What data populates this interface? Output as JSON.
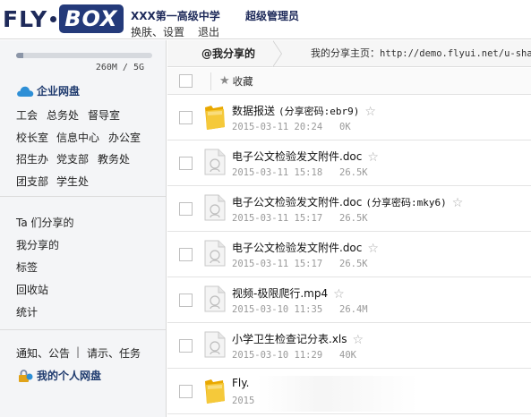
{
  "header": {
    "logo_left": "FLY",
    "logo_right": "BOX",
    "school": "XXX第一高级中学",
    "admin": "超级管理员",
    "links": [
      "换肤、设置",
      "退出"
    ]
  },
  "sidebar": {
    "quota_used_fraction": 0.05,
    "quota_text": "260M / 5G",
    "enterprise_title": "企业网盘",
    "departments": [
      [
        "工会",
        "总务处",
        "督导室"
      ],
      [
        "校长室",
        "信息中心",
        "办公室"
      ],
      [
        "招生办",
        "党支部",
        "教务处"
      ],
      [
        "团支部",
        "学生处"
      ]
    ],
    "nav": [
      "Ta 们分享的",
      "我分享的",
      "标签",
      "回收站",
      "统计"
    ],
    "notices": "通知、公告",
    "divider": "|",
    "requests": "请示、任务",
    "personal_title": "我的个人网盘"
  },
  "topbar": {
    "tab": "@我分享的",
    "share_home_label": "我的分享主页：",
    "share_url": "http://demo.flyui.net/u-sha"
  },
  "toolbar": {
    "favorite": "收藏"
  },
  "files": [
    {
      "type": "folder",
      "name": "数据报送",
      "code": "(分享密码:ebr9)",
      "date": "2015-03-11 20:24",
      "size": "0K"
    },
    {
      "type": "file",
      "name": "电子公文检验发文附件.doc",
      "code": "",
      "date": "2015-03-11 15:18",
      "size": "26.5K"
    },
    {
      "type": "file",
      "name": "电子公文检验发文附件.doc",
      "code": "(分享密码:mky6)",
      "date": "2015-03-11 15:17",
      "size": "26.5K"
    },
    {
      "type": "file",
      "name": "电子公文检验发文附件.doc",
      "code": "",
      "date": "2015-03-11 15:17",
      "size": "26.5K"
    },
    {
      "type": "file",
      "name": "视频-极限爬行.mp4",
      "code": "",
      "date": "2015-03-10 11:35",
      "size": "26.4M"
    },
    {
      "type": "file",
      "name": "小学卫生检查记分表.xls",
      "code": "",
      "date": "2015-03-10 11:29",
      "size": "40K"
    },
    {
      "type": "folder",
      "name": "Fly.",
      "code": "",
      "date": "2015",
      "size": ""
    }
  ],
  "colors": {
    "brand_navy": "#1e2a5a",
    "cloud_blue": "#2e8fd6",
    "folder_yellow": "#f2c21b"
  }
}
